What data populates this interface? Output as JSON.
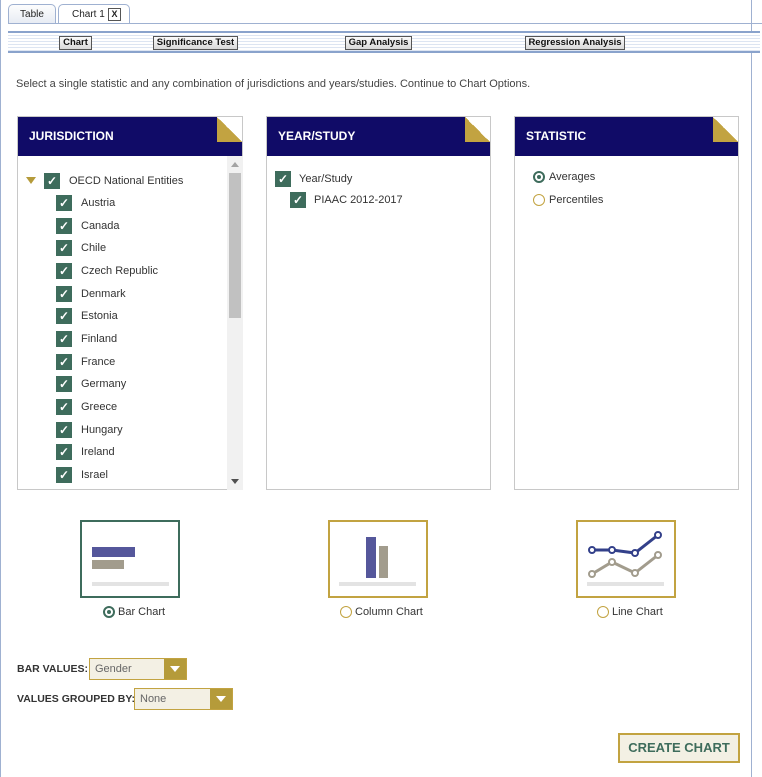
{
  "tabs": [
    {
      "label": "Table"
    },
    {
      "label": "Chart 1",
      "close": "X"
    }
  ],
  "toolbar": {
    "chart": "Chart",
    "significance": "Significance Test",
    "gap": "Gap Analysis",
    "regression": "Regression Analysis"
  },
  "instructions": "Select a single statistic and any combination of jurisdictions and years/studies. Continue to Chart Options.",
  "jurisdiction": {
    "title": "JURISDICTION",
    "group": "OECD National Entities",
    "items": [
      "Austria",
      "Canada",
      "Chile",
      "Czech Republic",
      "Denmark",
      "Estonia",
      "Finland",
      "France",
      "Germany",
      "Greece",
      "Hungary",
      "Ireland",
      "Israel"
    ]
  },
  "yearstudy": {
    "title": "YEAR/STUDY",
    "group": "Year/Study",
    "item": "PIAAC 2012-2017"
  },
  "statistic": {
    "title": "STATISTIC",
    "options": [
      {
        "label": "Averages",
        "selected": true
      },
      {
        "label": "Percentiles",
        "selected": false
      }
    ]
  },
  "chart_types": [
    {
      "label": "Bar Chart",
      "selected": true
    },
    {
      "label": "Column Chart",
      "selected": false
    },
    {
      "label": "Line Chart",
      "selected": false
    }
  ],
  "form": {
    "bar_values_label": "BAR VALUES:",
    "bar_values": "Gender",
    "grouped_label": "VALUES GROUPED BY:",
    "grouped": "None"
  },
  "create_label": "CREATE CHART",
  "colors": {
    "navy": "#100b67",
    "gold": "#c2a341",
    "green": "#3e6c5c"
  }
}
